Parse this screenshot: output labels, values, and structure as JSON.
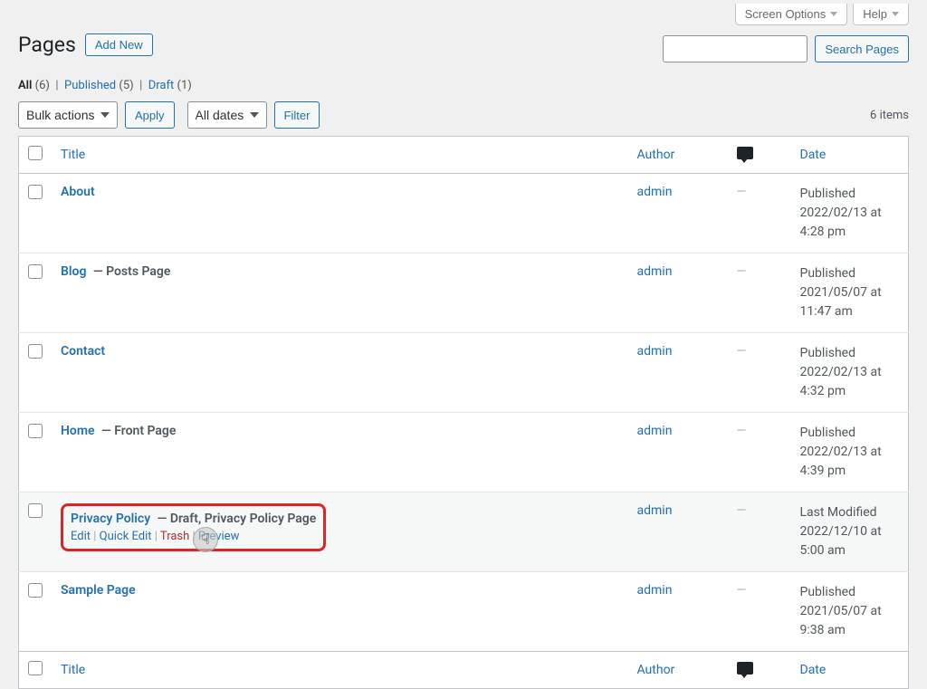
{
  "topTabs": {
    "screenOptions": "Screen Options",
    "help": "Help"
  },
  "header": {
    "title": "Pages",
    "addNew": "Add New"
  },
  "filters": {
    "all": "All",
    "allCount": "(6)",
    "published": "Published",
    "publishedCount": "(5)",
    "draft": "Draft",
    "draftCount": "(1)"
  },
  "bulk": {
    "select": "Bulk actions",
    "apply": "Apply"
  },
  "dateFilter": {
    "select": "All dates",
    "filter": "Filter"
  },
  "search": {
    "button": "Search Pages"
  },
  "totalItems": "6 items",
  "columns": {
    "title": "Title",
    "author": "Author",
    "date": "Date"
  },
  "rows": [
    {
      "title": "About",
      "suffix": "",
      "author": "admin",
      "comments": "—",
      "dateLabel": "Published",
      "dateValue": "2022/02/13 at 4:28 pm"
    },
    {
      "title": "Blog",
      "suffix": " — Posts Page",
      "author": "admin",
      "comments": "—",
      "dateLabel": "Published",
      "dateValue": "2021/05/07 at 11:47 am"
    },
    {
      "title": "Contact",
      "suffix": "",
      "author": "admin",
      "comments": "—",
      "dateLabel": "Published",
      "dateValue": "2022/02/13 at 4:32 pm"
    },
    {
      "title": "Home",
      "suffix": " — Front Page",
      "author": "admin",
      "comments": "—",
      "dateLabel": "Published",
      "dateValue": "2022/02/13 at 4:39 pm"
    },
    {
      "title": "Privacy Policy",
      "suffix": " — Draft, Privacy Policy Page",
      "author": "admin",
      "comments": "—",
      "dateLabel": "Last Modified",
      "dateValue": "2022/12/10 at 5:00 am"
    },
    {
      "title": "Sample Page",
      "suffix": "",
      "author": "admin",
      "comments": "—",
      "dateLabel": "Published",
      "dateValue": "2021/05/07 at 9:38 am"
    }
  ],
  "rowActions": {
    "edit": "Edit",
    "quickEdit": "Quick Edit",
    "trash": "Trash",
    "preview": "Preview"
  }
}
